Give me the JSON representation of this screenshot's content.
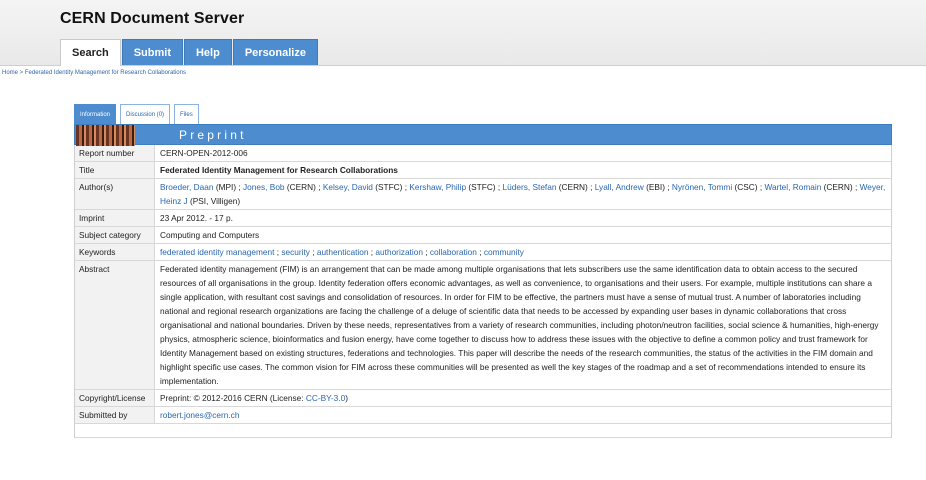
{
  "site": {
    "title": "CERN Document Server"
  },
  "nav": {
    "tabs": [
      {
        "label": "Search",
        "active": true
      },
      {
        "label": "Submit",
        "active": false
      },
      {
        "label": "Help",
        "active": false
      },
      {
        "label": "Personalize",
        "active": false
      }
    ]
  },
  "breadcrumb": {
    "home": "Home",
    "sep": " > ",
    "current": "Federated Identity Management for Research Collaborations"
  },
  "record_tabs": [
    "Information",
    "Discussion (0)",
    "Files"
  ],
  "banner": {
    "label": "Preprint"
  },
  "fields": {
    "report_number": {
      "label": "Report number",
      "value": "CERN-OPEN-2012-006"
    },
    "title": {
      "label": "Title",
      "value": "Federated Identity Management for Research Collaborations"
    },
    "authors": {
      "label": "Author(s)",
      "items": [
        {
          "name": "Broeder, Daan",
          "aff": " (MPI)"
        },
        {
          "name": "Jones, Bob",
          "aff": " (CERN)"
        },
        {
          "name": "Kelsey, David",
          "aff": " (STFC)"
        },
        {
          "name": "Kershaw, Philip",
          "aff": " (STFC)"
        },
        {
          "name": "Lüders, Stefan",
          "aff": " (CERN)"
        },
        {
          "name": "Lyall, Andrew",
          "aff": " (EBI)"
        },
        {
          "name": "Nyrönen, Tommi",
          "aff": " (CSC)"
        },
        {
          "name": "Wartel, Romain",
          "aff": " (CERN)"
        },
        {
          "name": "Weyer, Heinz J",
          "aff": " (PSI, Villigen)"
        }
      ]
    },
    "imprint": {
      "label": "Imprint",
      "value": "23 Apr 2012. - 17 p."
    },
    "subject": {
      "label": "Subject category",
      "value": "Computing and Computers"
    },
    "keywords": {
      "label": "Keywords",
      "items": [
        "federated identity management",
        "security",
        "authentication",
        "authorization",
        "collaboration",
        "community"
      ]
    },
    "abstract": {
      "label": "Abstract",
      "value": "Federated identity management (FIM) is an arrangement that can be made among multiple organisations that lets subscribers use the same identification data to obtain access to the secured resources of all organisations in the group. Identity federation offers economic advantages, as well as convenience, to organisations and their users. For example, multiple institutions can share a single application, with resultant cost savings and consolidation of resources. In order for FIM to be effective, the partners must have a sense of mutual trust. A number of laboratories including national and regional research organizations are facing the challenge of a deluge of scientific data that needs to be accessed by expanding user bases in dynamic collaborations that cross organisational and national boundaries. Driven by these needs, representatives from a variety of research communities, including photon/neutron facilities, social science & humanities, high-energy physics, atmospheric science, bioinformatics and fusion energy, have come together to discuss how to address these issues with the objective to define a common policy and trust framework for Identity Management based on existing structures, federations and technologies. This paper will describe the needs of the research communities, the status of the activities in the FIM domain and highlight specific use cases. The common vision for FIM across these communities will be presented as well the key stages of the roadmap and a set of recommendations intended to ensure its implementation."
    },
    "copyright": {
      "label": "Copyright/License",
      "prefix": "Preprint: © 2012-2016 CERN (License: ",
      "license": "CC-BY-3.0",
      "suffix": ")"
    },
    "submitted_by": {
      "label": "Submitted by",
      "value": "robert.jones@cern.ch"
    }
  }
}
